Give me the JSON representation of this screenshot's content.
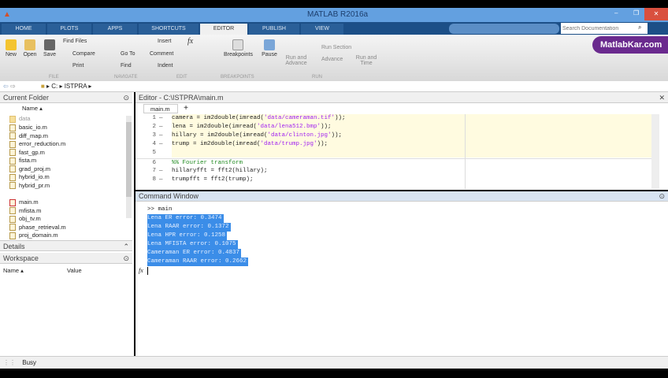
{
  "window": {
    "title": "MATLAB R2016a"
  },
  "tabs": [
    "HOME",
    "PLOTS",
    "APPS",
    "SHORTCUTS",
    "EDITOR",
    "PUBLISH",
    "VIEW"
  ],
  "search": {
    "placeholder": "Search Documentation"
  },
  "watermark": "MatlabKar.com",
  "ribbon": {
    "file": {
      "new": "New",
      "open": "Open",
      "save": "Save",
      "find_files": "Find Files",
      "compare": "Compare",
      "print": "Print",
      "group": "FILE"
    },
    "navigate": {
      "goto": "Go To",
      "find": "Find",
      "group": "NAVIGATE"
    },
    "edit": {
      "insert": "Insert",
      "comment": "Comment",
      "indent": "Indent",
      "fx": "fx",
      "group": "EDIT"
    },
    "breakpoints": {
      "label": "Breakpoints",
      "group": "BREAKPOINTS"
    },
    "run": {
      "pause": "Pause",
      "run_advance": "Run and Advance",
      "run_section": "Run Section",
      "advance": "Advance",
      "run_time": "Run and Time",
      "group": "RUN"
    }
  },
  "address": {
    "path": [
      "C:",
      "ISTPRA"
    ]
  },
  "current_folder": {
    "title": "Current Folder",
    "col": "Name ▴",
    "items": [
      "data",
      "basic_io.m",
      "diff_map.m",
      "error_reduction.m",
      "fast_gp.m",
      "fista.m",
      "grad_proj.m",
      "hybrid_io.m",
      "hybrid_pr.m",
      "main.m",
      "mfista.m",
      "obj_tv.m",
      "phase_retrieval.m",
      "proj_domain.m"
    ]
  },
  "details": {
    "title": "Details"
  },
  "workspace": {
    "title": "Workspace",
    "col_name": "Name ▴",
    "col_value": "Value"
  },
  "editor": {
    "title": "Editor - C:\\ISTPRA\\main.m",
    "tab": "main.m",
    "add_tab": "+",
    "lines": [
      {
        "n": "1",
        "d": "—",
        "pre": "camera = im2double(imread(",
        "str": "'data/cameraman.tif'",
        "post": "));"
      },
      {
        "n": "2",
        "d": "—",
        "pre": "lena = im2double(imread(",
        "str": "'data/lena512.bmp'",
        "post": "));"
      },
      {
        "n": "3",
        "d": "—",
        "pre": "hillary = im2double(imread(",
        "str": "'data/clinton.jpg'",
        "post": "));"
      },
      {
        "n": "4",
        "d": "—",
        "pre": "trump = im2double(imread(",
        "str": "'data/trump.jpg'",
        "post": "));"
      },
      {
        "n": "5",
        "d": "",
        "pre": "",
        "str": "",
        "post": ""
      },
      {
        "n": "6",
        "d": "",
        "cmt": "%% Fourier transform"
      },
      {
        "n": "7",
        "d": "—",
        "pre": "hillaryfft = fft2(hillary);",
        "str": "",
        "post": ""
      },
      {
        "n": "8",
        "d": "—",
        "pre": "trumpfft = fft2(trump);",
        "str": "",
        "post": ""
      }
    ]
  },
  "command_window": {
    "title": "Command Window",
    "prompt": ">> main",
    "fx": "fx",
    "output": [
      "Lena ER error: 0.3474",
      "Lena RAAR error: 0.1372",
      "Lena HPR error: 0.1258",
      "Lena MFISTA error: 0.1075",
      "Cameraman ER error: 0.4837",
      "Cameraman RAAR error: 0.2662"
    ]
  },
  "status": "Busy"
}
